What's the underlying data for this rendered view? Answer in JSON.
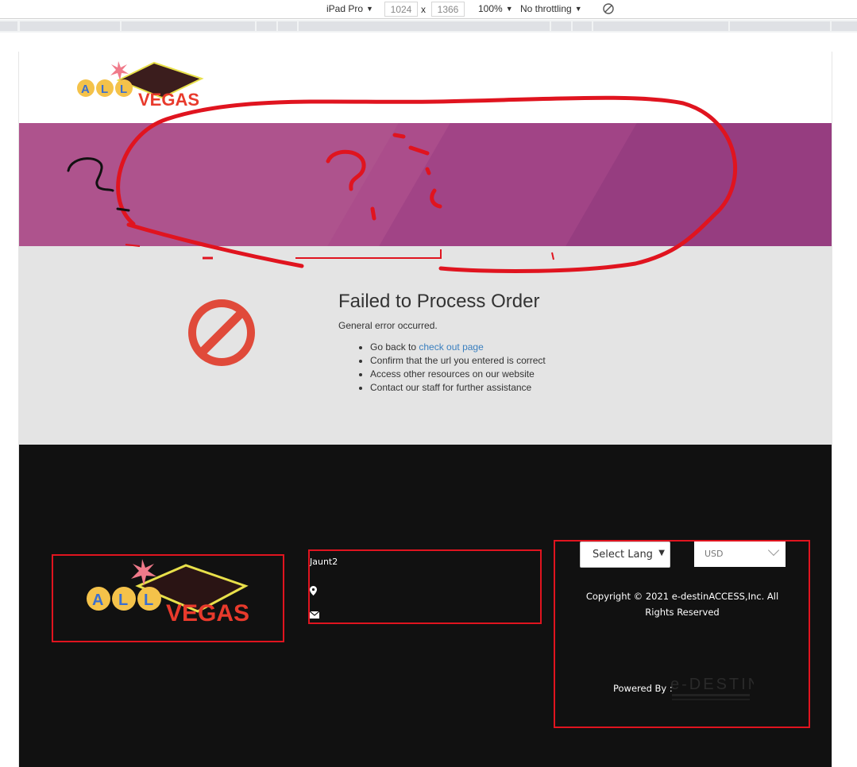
{
  "devtools": {
    "device": "iPad Pro",
    "width": "1024",
    "times": "x",
    "height": "1366",
    "zoom": "100%",
    "throttling": "No throttling"
  },
  "header": {
    "logo_alt": "ALL VEGAS"
  },
  "error": {
    "title": "Failed to Process Order",
    "subtitle": "General error occurred.",
    "items": [
      {
        "prefix": "Go back to ",
        "link": "check out page"
      },
      {
        "text": "Confirm that the url you entered is correct"
      },
      {
        "text": "Access other resources on our website"
      },
      {
        "text": "Contact our staff for further assistance"
      }
    ]
  },
  "footer": {
    "company": "Jaunt2",
    "language_select": "Select Lang",
    "currency_select": "USD",
    "copyright": "Copyright © 2021 e-destinACCESS,Inc. All Rights Reserved",
    "powered_by": "Powered By :",
    "edestin_logo": "e-DESTIN"
  },
  "colors": {
    "banner": "#963d80",
    "footer": "#111111",
    "annotation": "#e0141f",
    "error_icon": "#e04a3a"
  }
}
